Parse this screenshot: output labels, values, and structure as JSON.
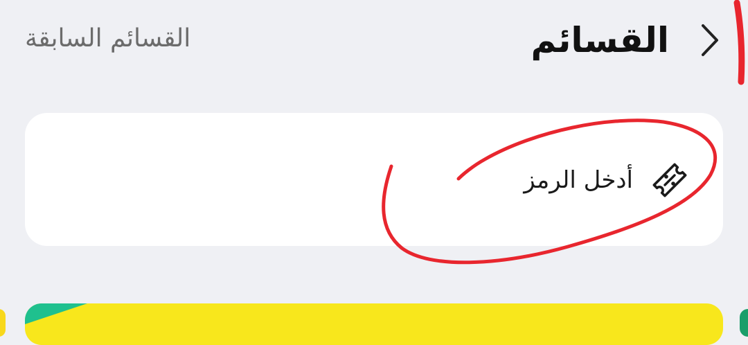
{
  "header": {
    "title": "القسائم",
    "previous_link": "القسائم السابقة",
    "back_icon": "chevron-right-icon"
  },
  "code_card": {
    "label": "أدخل الرمز",
    "icon": "coupon-ticket-icon"
  },
  "colors": {
    "background": "#eff0f4",
    "card": "#ffffff",
    "title_text": "#111111",
    "secondary_text": "#6b6b6b",
    "annotation": "#e8262e",
    "banner_yellow": "#f8e71c",
    "banner_green": "#1fc08e"
  }
}
